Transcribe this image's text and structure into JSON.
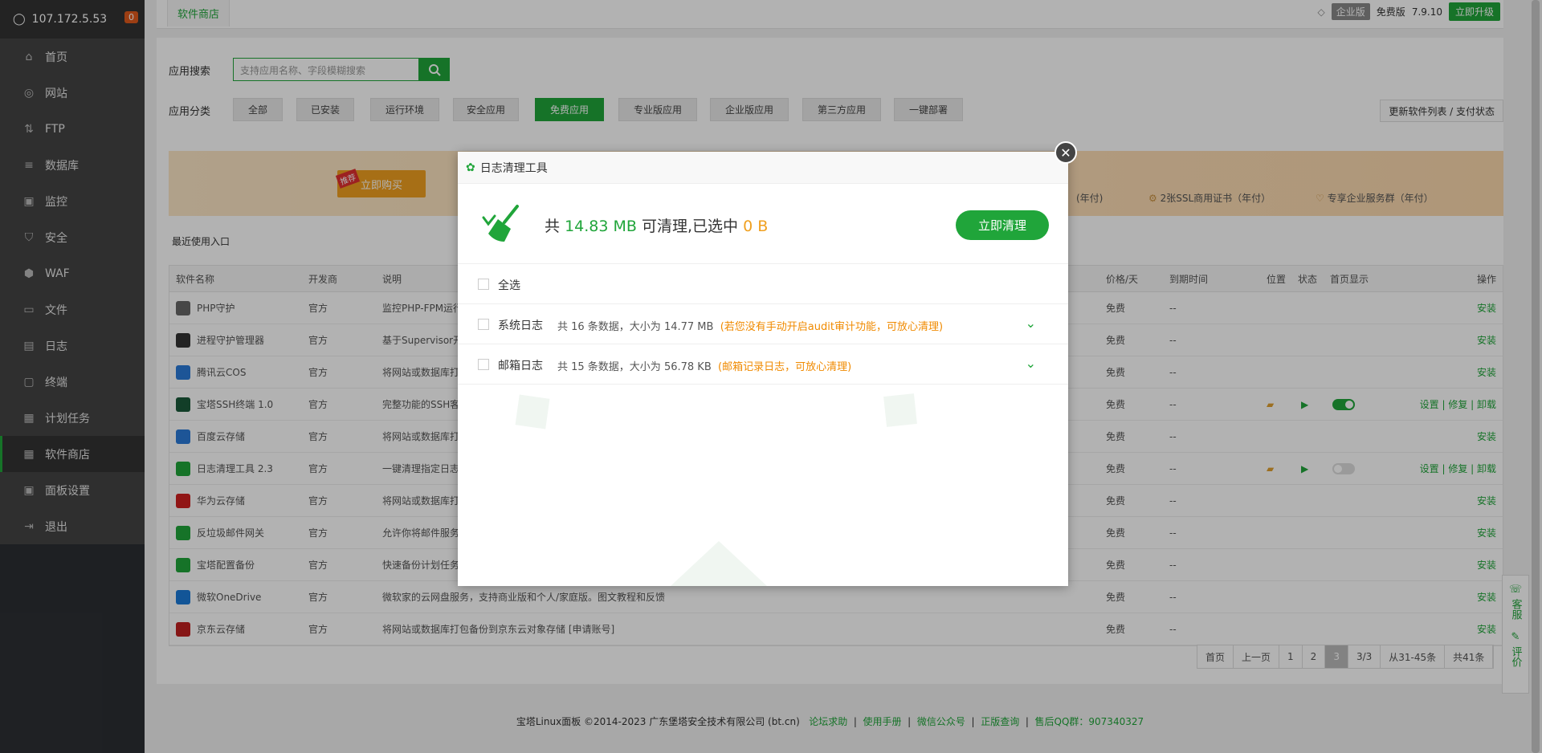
{
  "server": {
    "ip": "107.172.5.53",
    "badge": "0"
  },
  "sidebar": {
    "items": [
      {
        "label": "首页",
        "icon": "home-icon"
      },
      {
        "label": "网站",
        "icon": "globe-icon"
      },
      {
        "label": "FTP",
        "icon": "ftp-icon"
      },
      {
        "label": "数据库",
        "icon": "database-icon"
      },
      {
        "label": "监控",
        "icon": "monitor-icon"
      },
      {
        "label": "安全",
        "icon": "shield-icon"
      },
      {
        "label": "WAF",
        "icon": "waf-icon"
      },
      {
        "label": "文件",
        "icon": "folder-icon"
      },
      {
        "label": "日志",
        "icon": "log-icon"
      },
      {
        "label": "终端",
        "icon": "terminal-icon"
      },
      {
        "label": "计划任务",
        "icon": "calendar-icon"
      },
      {
        "label": "软件商店",
        "icon": "grid-icon"
      },
      {
        "label": "面板设置",
        "icon": "settings-icon"
      },
      {
        "label": "退出",
        "icon": "logout-icon"
      }
    ]
  },
  "header": {
    "tab": "软件商店",
    "edition": "企业版",
    "free": "免费版",
    "version": "7.9.10",
    "upgrade": "立即升级"
  },
  "store": {
    "search_label": "应用搜索",
    "search_placeholder": "支持应用名称、字段模糊搜索",
    "category_label": "应用分类",
    "categories": [
      "全部",
      "已安装",
      "运行环境",
      "安全应用",
      "免费应用",
      "专业版应用",
      "企业版应用",
      "第三方应用",
      "一键部署"
    ],
    "update_btn": "更新软件列表 / 支付状态",
    "banner": {
      "tag": "推荐",
      "buy": "立即购买",
      "f1": "(年付)",
      "f2": "2张SSL商用证书（年付）",
      "f3": "专享企业服务群（年付）"
    },
    "recent": "最近使用入口"
  },
  "table": {
    "headers": {
      "name": "软件名称",
      "dev": "开发商",
      "desc": "说明",
      "price": "价格/天",
      "expire": "到期时间",
      "pos": "位置",
      "state": "状态",
      "home": "首页显示",
      "ops": "操作"
    },
    "rows": [
      {
        "name": "PHP守护",
        "dev": "官方",
        "desc": "监控PHP-FPM运行",
        "price": "免费",
        "expire": "--",
        "ops": "安装"
      },
      {
        "name": "进程守护管理器",
        "dev": "官方",
        "desc": "基于Supervisor开",
        "price": "免费",
        "expire": "--",
        "ops": "安装"
      },
      {
        "name": "腾讯云COS",
        "dev": "官方",
        "desc": "将网站或数据库打",
        "price": "免费",
        "expire": "--",
        "ops": "安装"
      },
      {
        "name": "宝塔SSH终端 1.0",
        "dev": "官方",
        "desc": "完整功能的SSH客",
        "price": "免费",
        "expire": "--",
        "ops": "设置 | 修复 | 卸载"
      },
      {
        "name": "百度云存储",
        "dev": "官方",
        "desc": "将网站或数据库打",
        "price": "免费",
        "expire": "--",
        "ops": "安装"
      },
      {
        "name": "日志清理工具 2.3",
        "dev": "官方",
        "desc": "一键清理指定日志",
        "price": "免费",
        "expire": "--",
        "ops": "设置 | 修复 | 卸载"
      },
      {
        "name": "华为云存储",
        "dev": "官方",
        "desc": "将网站或数据库打",
        "price": "免费",
        "expire": "--",
        "ops": "安装"
      },
      {
        "name": "反垃圾邮件网关",
        "dev": "官方",
        "desc": "允许你将邮件服务",
        "price": "免费",
        "expire": "--",
        "ops": "安装"
      },
      {
        "name": "宝塔配置备份",
        "dev": "官方",
        "desc": "快速备份计划任务",
        "price": "免费",
        "expire": "--",
        "ops": "安装"
      },
      {
        "name": "微软OneDrive",
        "dev": "官方",
        "desc": "微软家的云网盘服务，支持商业版和个人/家庭版。图文教程和反馈",
        "price": "免费",
        "expire": "--",
        "ops": "安装"
      },
      {
        "name": "京东云存储",
        "dev": "官方",
        "desc": "将网站或数据库打包备份到京东云对象存储 [申请账号]",
        "price": "免费",
        "expire": "--",
        "ops": "安装"
      }
    ]
  },
  "pager": {
    "first": "首页",
    "prev": "上一页",
    "p1": "1",
    "p2": "2",
    "p3": "3",
    "total_pages": "3/3",
    "range": "从31-45条",
    "total": "共41条"
  },
  "footer": {
    "copyright": "宝塔Linux面板 ©2014-2023 广东堡塔安全技术有限公司 (bt.cn)",
    "links": [
      "论坛求助",
      "使用手册",
      "微信公众号",
      "正版查询",
      "售后QQ群：907340327"
    ]
  },
  "help": {
    "service": "客服",
    "review": "评价"
  },
  "modal": {
    "title": "日志清理工具",
    "summary_prefix": "共",
    "total_size": "14.83 MB",
    "summary_mid": "可清理,已选中",
    "selected": "0 B",
    "clean_btn": "立即清理",
    "select_all": "全选",
    "rows": [
      {
        "name": "系统日志",
        "info": "共 16 条数据，大小为 14.77 MB",
        "note": "(若您没有手动开启audit审计功能，可放心清理)"
      },
      {
        "name": "邮箱日志",
        "info": "共 15 条数据，大小为 56.78 KB",
        "note": "(邮箱记录日志，可放心清理)"
      }
    ]
  },
  "colors": {
    "accent": "#20a53a",
    "warning": "#f0a020",
    "sidebar": "#444444"
  }
}
